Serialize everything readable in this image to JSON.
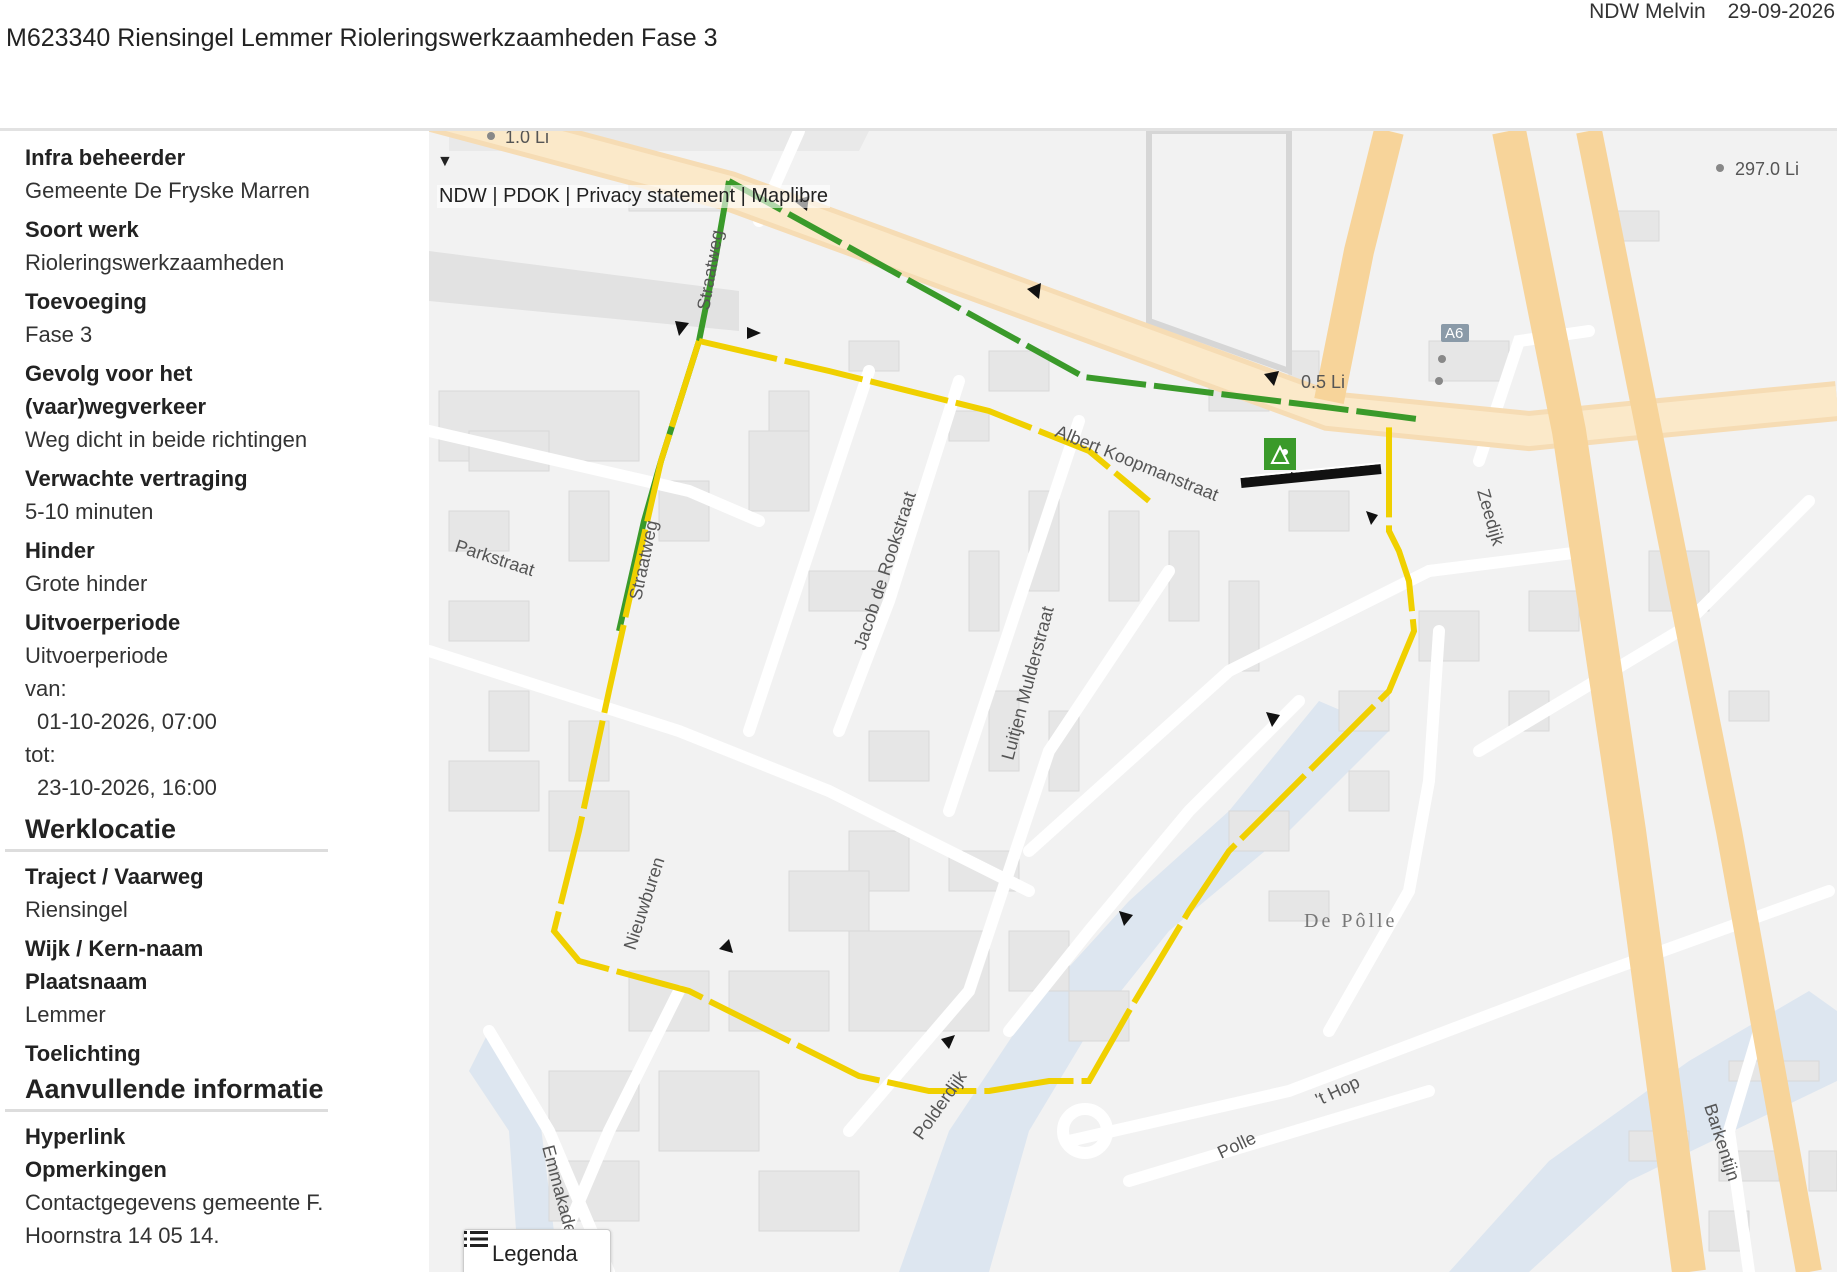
{
  "header": {
    "title": "M623340 Riensingel Lemmer Rioleringswerkzaamheden Fase 3",
    "user": "NDW Melvin",
    "date": "29-09-2026"
  },
  "details": {
    "infra_label": "Infra beheerder",
    "infra_value": "Gemeente De Fryske Marren",
    "soort_label": "Soort werk",
    "soort_value": "Rioleringswerkzaamheden",
    "toevoeging_label": "Toevoeging",
    "toevoeging_value": "Fase 3",
    "gevolg_label_1": "Gevolg voor het",
    "gevolg_label_2": "(vaar)wegverkeer",
    "gevolg_value": "Weg dicht in beide richtingen",
    "vertraging_label": "Verwachte vertraging",
    "vertraging_value": "5-10 minuten",
    "hinder_label": "Hinder",
    "hinder_value": "Grote hinder",
    "periode_label": "Uitvoerperiode",
    "periode_value": "Uitvoerperiode",
    "van_label": "van:",
    "van_value": "01-10-2026, 07:00",
    "tot_label": "tot:",
    "tot_value": "23-10-2026, 16:00"
  },
  "werklocatie": {
    "heading": "Werklocatie",
    "traject_label": "Traject / Vaarweg",
    "traject_value": "Riensingel",
    "wijk_label": "Wijk / Kern-naam",
    "plaats_label": "Plaatsnaam",
    "plaats_value": "Lemmer",
    "toelichting_label": "Toelichting"
  },
  "aanvullend": {
    "heading": "Aanvullende informatie",
    "hyperlink_label": "Hyperlink",
    "opmerkingen_label": "Opmerkingen",
    "opmerkingen_value_1": "Contactgegevens gemeente F.",
    "opmerkingen_value_2": "Hoornstra 14 05 14."
  },
  "map": {
    "toggle_icon": "caret-down-icon",
    "attribution": "NDW | PDOK | Privacy statement | Maplibre",
    "legend_label": "Legenda",
    "legend_icon": "list-icon",
    "streets": {
      "straatweg_top": "Straatweg",
      "straatweg_mid": "Straatweg",
      "albert": "Albert Koopmanstraat",
      "jacob": "Jacob de Rookstraat",
      "luitjen": "Luitjen Mulderstraat",
      "parkstraat": "Parkstraat",
      "nieuwburen": "Nieuwburen",
      "zeedijk": "Zeedijk",
      "polderdijk": "Polderdijk",
      "polle": "Polle",
      "hop": "'t Hop",
      "emmakade": "Emmakade",
      "barkentijn": "Barkentijn",
      "area": "De Pôlle",
      "a6": "A6",
      "km1": "1.0 Li",
      "km2": "0.5 Li",
      "km3": "297.0 Li"
    },
    "colors": {
      "detour_yellow": "#f0d000",
      "detour_green": "#3a9a2a",
      "closure_black": "#111111",
      "highway": "#f7d9a0",
      "water": "#dde6f0"
    }
  }
}
